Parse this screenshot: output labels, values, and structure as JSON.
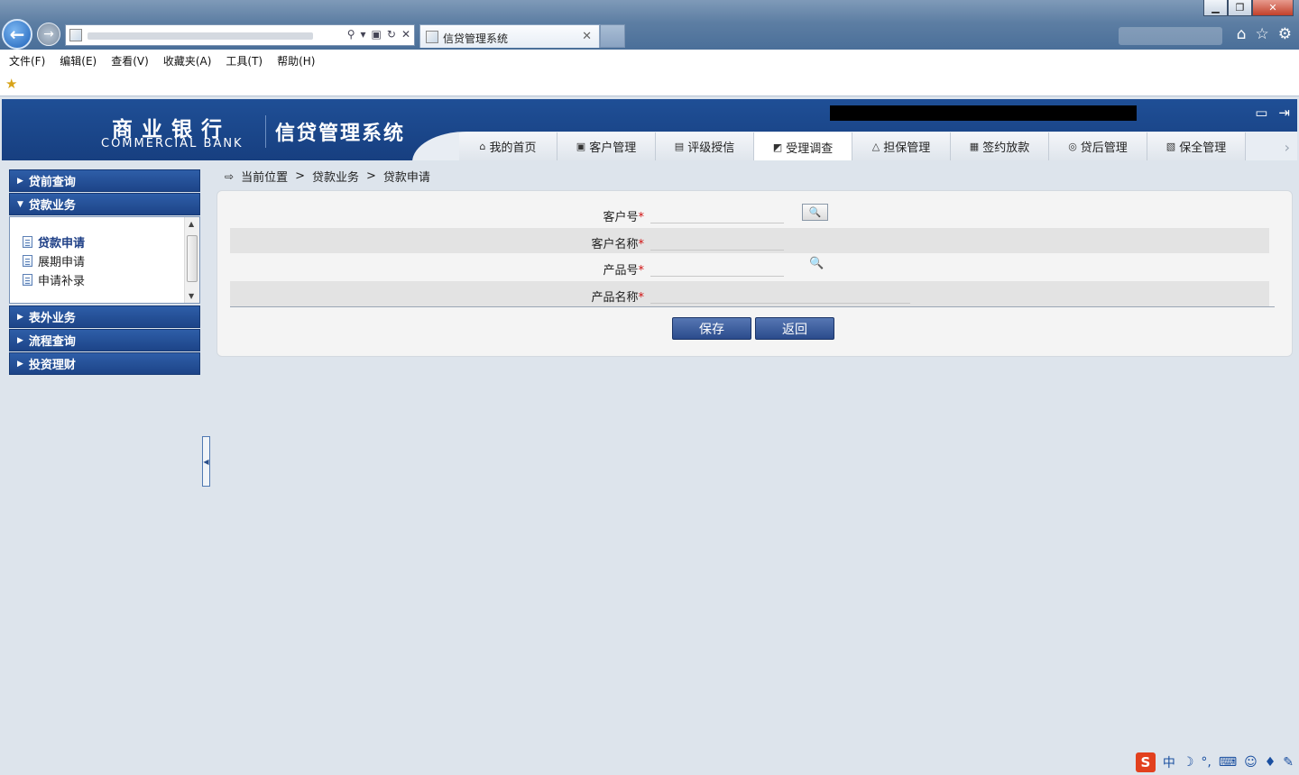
{
  "browser": {
    "tab_title": "信贷管理系统",
    "menu": [
      "文件(F)",
      "编辑(E)",
      "查看(V)",
      "收藏夹(A)",
      "工具(T)",
      "帮助(H)"
    ]
  },
  "header": {
    "bank_cn": "商业银行",
    "bank_en": "COMMERCIAL BANK",
    "system_name": "信贷管理系统"
  },
  "nav": {
    "tabs": [
      {
        "label": "我的首页",
        "icon": "home-icon"
      },
      {
        "label": "客户管理",
        "icon": "customer-icon"
      },
      {
        "label": "评级授信",
        "icon": "rating-icon"
      },
      {
        "label": "受理调查",
        "icon": "survey-icon",
        "active": true
      },
      {
        "label": "担保管理",
        "icon": "guarantee-icon"
      },
      {
        "label": "签约放款",
        "icon": "contract-icon"
      },
      {
        "label": "贷后管理",
        "icon": "post-loan-icon"
      },
      {
        "label": "保全管理",
        "icon": "preservation-icon"
      }
    ]
  },
  "sidebar": {
    "groups": [
      {
        "label": "贷前查询",
        "expanded": false
      },
      {
        "label": "贷款业务",
        "expanded": true,
        "items": [
          "贷款申请",
          "展期申请",
          "申请补录"
        ],
        "selected": "贷款申请"
      },
      {
        "label": "表外业务",
        "expanded": false
      },
      {
        "label": "流程查询",
        "expanded": false
      },
      {
        "label": "投资理财",
        "expanded": false
      }
    ]
  },
  "breadcrumb": {
    "prefix": "当前位置",
    "sep": ">",
    "level1": "贷款业务",
    "level2": "贷款申请"
  },
  "form": {
    "customer_no": {
      "label": "客户号",
      "required": "*",
      "value": ""
    },
    "customer_name": {
      "label": "客户名称",
      "required": "*",
      "value": ""
    },
    "product_no": {
      "label": "产品号",
      "required": "*",
      "value": ""
    },
    "product_name": {
      "label": "产品名称",
      "required": "*",
      "value": ""
    },
    "save_label": "保存",
    "back_label": "返回"
  },
  "ime": {
    "mode": "中"
  },
  "colors": {
    "header_blue": "#1f4f96",
    "button_blue": "#2b4b8c",
    "required_red": "#d01010"
  }
}
